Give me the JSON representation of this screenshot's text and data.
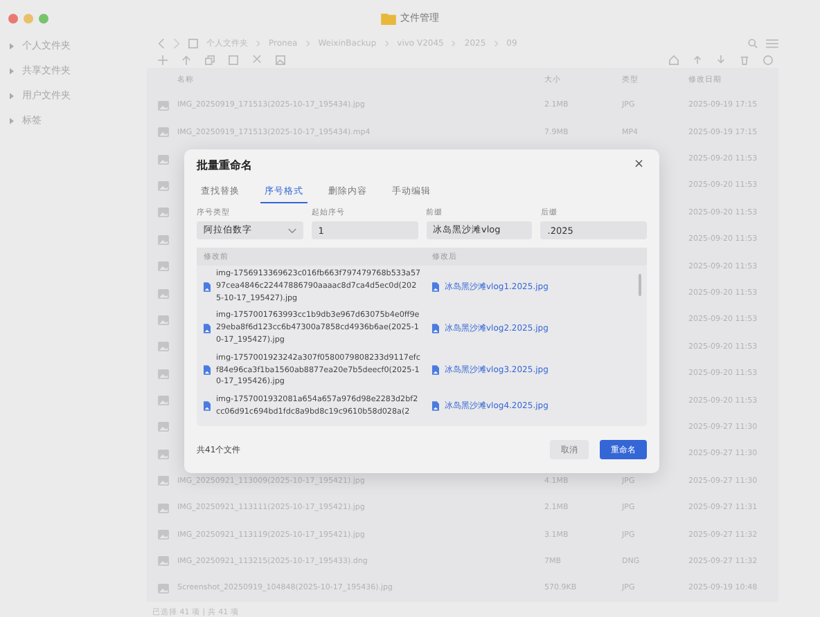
{
  "window": {
    "title": "文件管理"
  },
  "sidebar": {
    "items": [
      {
        "label": "个人文件夹",
        "expanded": false
      },
      {
        "label": "共享文件夹",
        "expanded": false
      },
      {
        "label": "用户文件夹",
        "expanded": false
      },
      {
        "label": "标签",
        "expanded": false
      }
    ]
  },
  "breadcrumb": [
    "个人文件夹",
    "Pronea",
    "WeixinBackup",
    "vivo V2045",
    "2025",
    "09"
  ],
  "table": {
    "columns": [
      "名称",
      "大小",
      "类型",
      "修改日期"
    ],
    "rows": [
      {
        "kind": "full",
        "name": "IMG_20250919_171513(2025-10-17_195434).jpg",
        "size": "2.1MB",
        "type": "JPG",
        "date": "2025-09-19 17:15"
      },
      {
        "kind": "full",
        "name": "IMG_20250919_171513(2025-10-17_195434).mp4",
        "size": "7.9MB",
        "type": "MP4",
        "date": "2025-09-19 17:15"
      },
      {
        "kind": "covered",
        "date": "2025-09-20 11:53"
      },
      {
        "kind": "covered",
        "date": "2025-09-20 11:53"
      },
      {
        "kind": "covered",
        "date": "2025-09-20 11:53"
      },
      {
        "kind": "covered",
        "date": "2025-09-20 11:53"
      },
      {
        "kind": "covered",
        "date": "2025-09-20 11:53"
      },
      {
        "kind": "covered",
        "date": "2025-09-20 11:53"
      },
      {
        "kind": "covered",
        "date": "2025-09-20 11:53"
      },
      {
        "kind": "covered",
        "date": "2025-09-20 11:53"
      },
      {
        "kind": "covered",
        "date": "2025-09-20 11:53"
      },
      {
        "kind": "covered",
        "date": "2025-09-20 11:53"
      },
      {
        "kind": "covered",
        "date": "2025-09-27 11:30"
      },
      {
        "kind": "covered",
        "date": "2025-09-27 11:30"
      },
      {
        "kind": "full",
        "name": "IMG_20250921_113009(2025-10-17_195421).jpg",
        "size": "4.1MB",
        "type": "JPG",
        "date": "2025-09-27 11:30"
      },
      {
        "kind": "full",
        "name": "IMG_20250921_113111(2025-10-17_195421).jpg",
        "size": "2.1MB",
        "type": "JPG",
        "date": "2025-09-27 11:31"
      },
      {
        "kind": "full",
        "name": "IMG_20250921_113119(2025-10-17_195421).jpg",
        "size": "3.1MB",
        "type": "JPG",
        "date": "2025-09-27 11:32"
      },
      {
        "kind": "full",
        "name": "IMG_20250921_113215(2025-10-17_195433).dng",
        "size": "7MB",
        "type": "DNG",
        "date": "2025-09-27 11:32"
      },
      {
        "kind": "full",
        "name": "Screenshot_20250919_104848(2025-10-17_195436).jpg",
        "size": "570.9KB",
        "type": "JPG",
        "date": "2025-09-19 10:48"
      }
    ]
  },
  "status_bar": "已选择 41 项 | 共 41 项",
  "dialog": {
    "title": "批量重命名",
    "close": "×",
    "tabs": [
      {
        "label": "查找替换",
        "selected": false
      },
      {
        "label": "序号格式",
        "selected": true
      },
      {
        "label": "删除内容",
        "selected": false
      },
      {
        "label": "手动编辑",
        "selected": false
      }
    ],
    "fields": [
      {
        "kind": "select",
        "label": "序号类型",
        "value": "阿拉伯数字"
      },
      {
        "kind": "input",
        "label": "起始序号",
        "value": "1"
      },
      {
        "kind": "input",
        "label": "前缀",
        "value": "冰岛黑沙滩vlog"
      },
      {
        "kind": "input",
        "label": "后缀",
        "value": ".2025"
      }
    ],
    "preview": {
      "columns": [
        "修改前",
        "修改后"
      ],
      "rows": [
        {
          "before": "img-1756913369623c016fb663f797479768b533a5797cea4846c22447886790aaaac8d7ca4d5ec0d(2025-10-17_195427).jpg",
          "after": "冰岛黑沙滩vlog1.2025.jpg"
        },
        {
          "before": "img-1757001763993cc1b9db3e967d63075b4e0ff9e29eba8f6d123cc6b47300a7858cd4936b6ae(2025-10-17_195427).jpg",
          "after": "冰岛黑沙滩vlog2.2025.jpg"
        },
        {
          "before": "img-1757001923242a307f0580079808233d9117efcf84e96ca3f1ba1560ab8877ea20e7b5deecf0(2025-10-17_195426).jpg",
          "after": "冰岛黑沙滩vlog3.2025.jpg"
        },
        {
          "before": "img-1757001932081a654a657a976d98e2283d2bf2cc06d91c694bd1fdc8a9bd8c19c9610b58d028a(2",
          "after": "冰岛黑沙滩vlog4.2025.jpg"
        }
      ]
    },
    "count": "共41个文件",
    "buttons": [
      {
        "label": "取消",
        "kind": "secondary"
      },
      {
        "label": "重命名",
        "kind": "primary"
      }
    ]
  }
}
